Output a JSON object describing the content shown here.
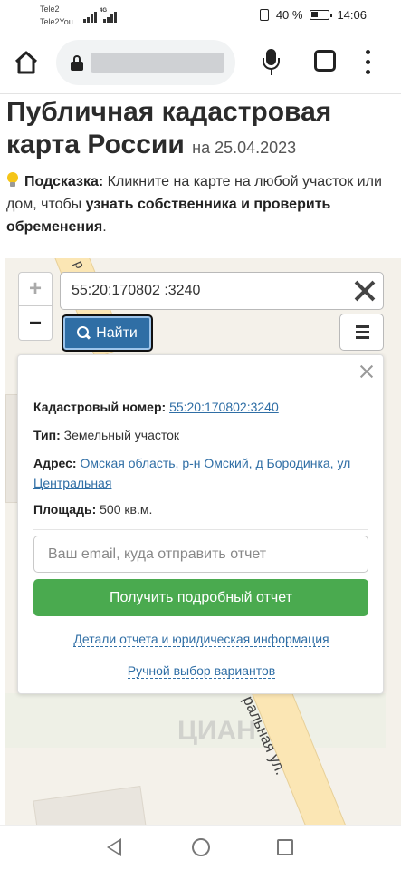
{
  "status_bar": {
    "carrier1": "Tele2",
    "carrier2": "Tele2You",
    "network": "4G",
    "battery": "40 %",
    "time": "14:06"
  },
  "browser": {
    "icons": [
      "home-icon",
      "lock-icon",
      "mic-icon",
      "tabs-icon",
      "more-vert-icon"
    ]
  },
  "page": {
    "title": "Публичная кадастровая карта России",
    "date": "на 25.04.2023",
    "hint_label": "Подсказка:",
    "hint_text1": "Кликните на карте на любой участок или дом, чтобы",
    "hint_bold": "узнать собственника и проверить обременения",
    "hint_end": "."
  },
  "map": {
    "zoom_in": "+",
    "zoom_out": "−",
    "search_value": "55:20:170802 :3240",
    "find_label": "Найти",
    "street_fragment": "р",
    "street_label": "ральная ул.",
    "watermark": "ЦИАН"
  },
  "card": {
    "cad_label": "Кадастровый номер:",
    "cad_value": "55:20:170802:3240",
    "type_label": "Тип:",
    "type_value": "Земельный участок",
    "address_label": "Адрес:",
    "address_value": "Омская область, р-н Омский, д Бородинка, ул Центральная",
    "area_label": "Площадь:",
    "area_value": "500 кв.м.",
    "email_placeholder": "Ваш email, куда отправить отчет",
    "report_button": "Получить подробный отчет",
    "details_link": "Детали отчета и юридическая информация",
    "manual_link": "Ручной выбор вариантов"
  },
  "colors": {
    "link": "#2f6ea5",
    "find_button": "#2f6ea5",
    "report_button": "#4aaa4f"
  }
}
